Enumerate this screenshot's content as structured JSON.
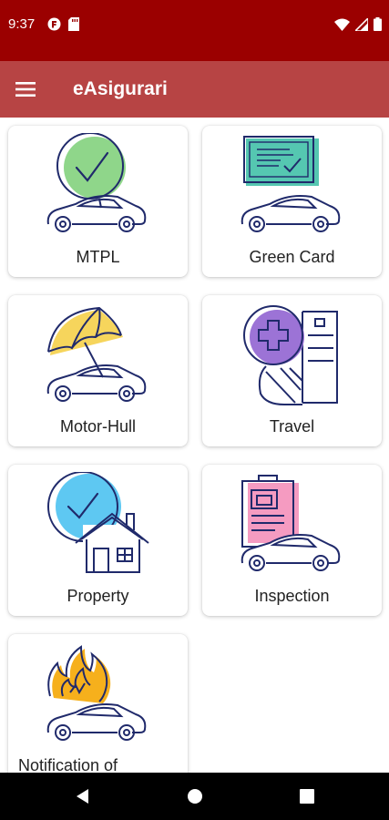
{
  "status_bar": {
    "time": "9:37",
    "left_icons": [
      "app-notification-icon",
      "sd-card-icon"
    ],
    "right_icons": [
      "wifi-icon",
      "signal-icon",
      "battery-icon"
    ]
  },
  "app_bar": {
    "title": "eAsigurari",
    "menu_icon": "hamburger-menu-icon"
  },
  "cards": [
    {
      "label": "MTPL",
      "icon": "car-check-icon",
      "accent": "#8fd68a"
    },
    {
      "label": "Green Card",
      "icon": "car-document-icon",
      "accent": "#55c7b1"
    },
    {
      "label": "Motor-Hull",
      "icon": "car-umbrella-icon",
      "accent": "#f6d55c"
    },
    {
      "label": "Travel",
      "icon": "travel-medical-map-icon",
      "accent": "#9c73d6"
    },
    {
      "label": "Property",
      "icon": "house-check-icon",
      "accent": "#5ec8f2"
    },
    {
      "label": "Inspection",
      "icon": "car-clipboard-icon",
      "accent": "#f59bc1"
    },
    {
      "label": "Notification of",
      "icon": "car-fire-icon",
      "accent": "#f6b01c"
    }
  ],
  "colors": {
    "status_bar": "#9b0000",
    "app_bar": "#b74444",
    "line_art": "#202a6b"
  },
  "nav_bar": {
    "buttons": [
      "back-icon",
      "home-icon",
      "recents-icon"
    ]
  }
}
